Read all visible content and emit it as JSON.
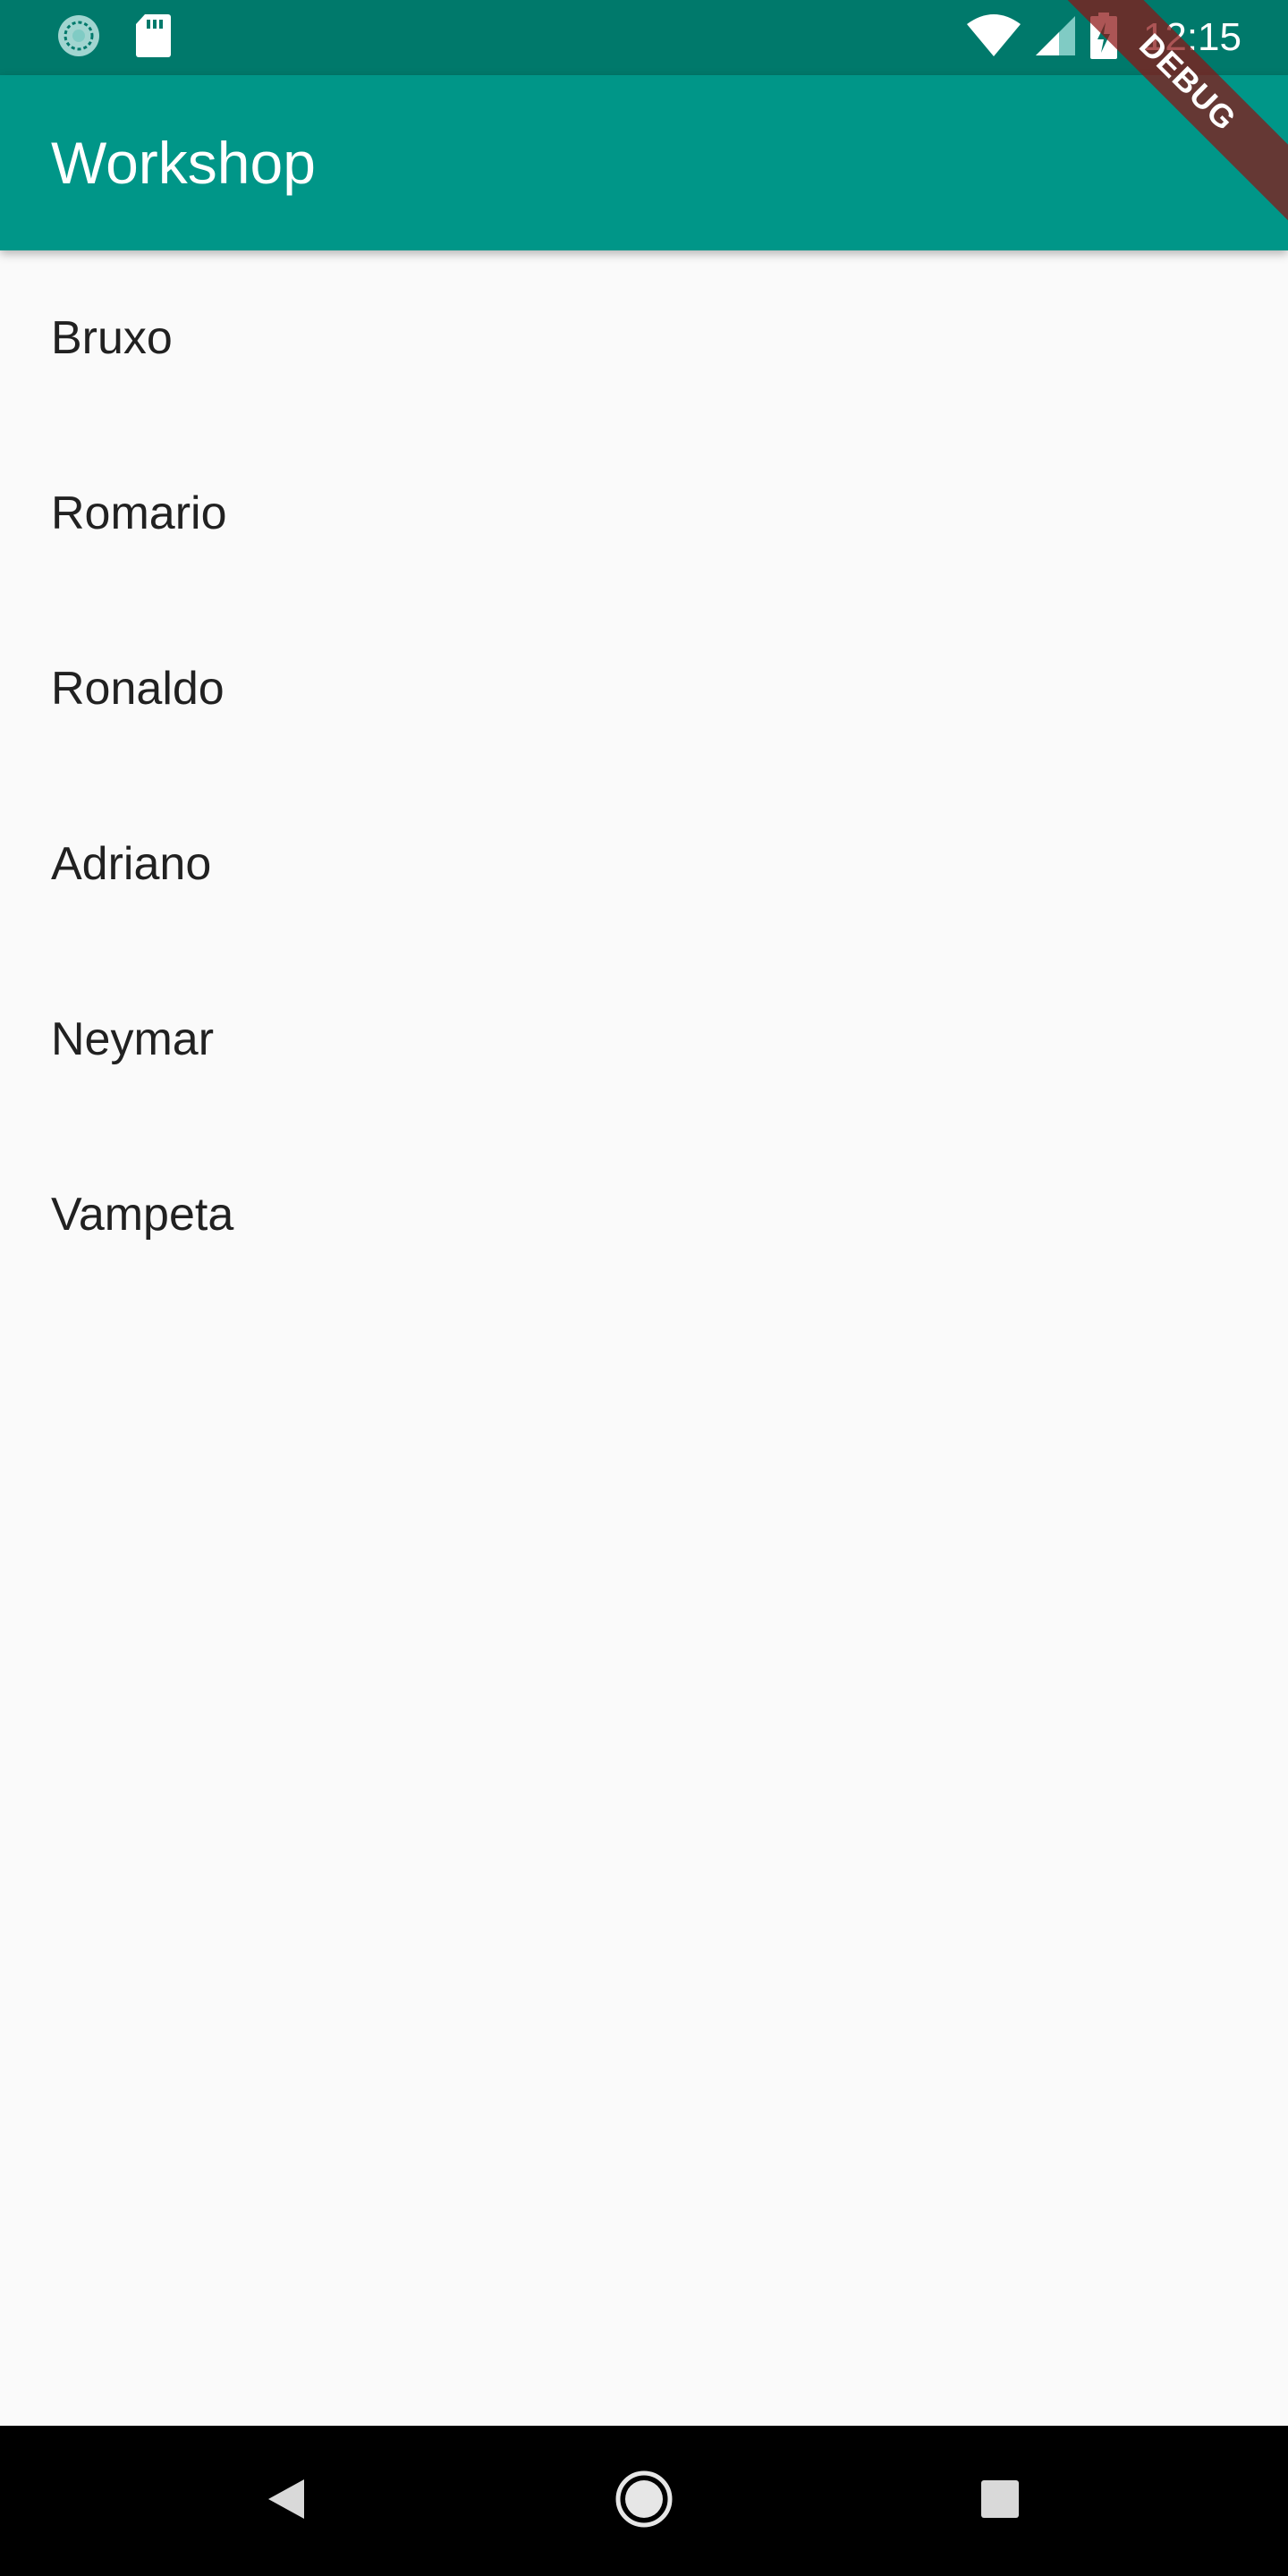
{
  "status_bar": {
    "time": "12:15",
    "left_icons": [
      "sync-icon",
      "sd-card-icon"
    ],
    "right_icons": [
      "wifi-icon",
      "cell-signal-icon",
      "battery-charging-icon"
    ]
  },
  "debug_banner": {
    "label": "DEBUG"
  },
  "app_bar": {
    "title": "Workshop",
    "color": "#009688",
    "status_color": "#00796b"
  },
  "list": {
    "items": [
      {
        "label": "Bruxo"
      },
      {
        "label": "Romario"
      },
      {
        "label": "Ronaldo"
      },
      {
        "label": "Adriano"
      },
      {
        "label": "Neymar"
      },
      {
        "label": "Vampeta"
      }
    ]
  },
  "nav_bar": {
    "buttons": [
      "back-icon",
      "home-icon",
      "recents-icon"
    ]
  }
}
